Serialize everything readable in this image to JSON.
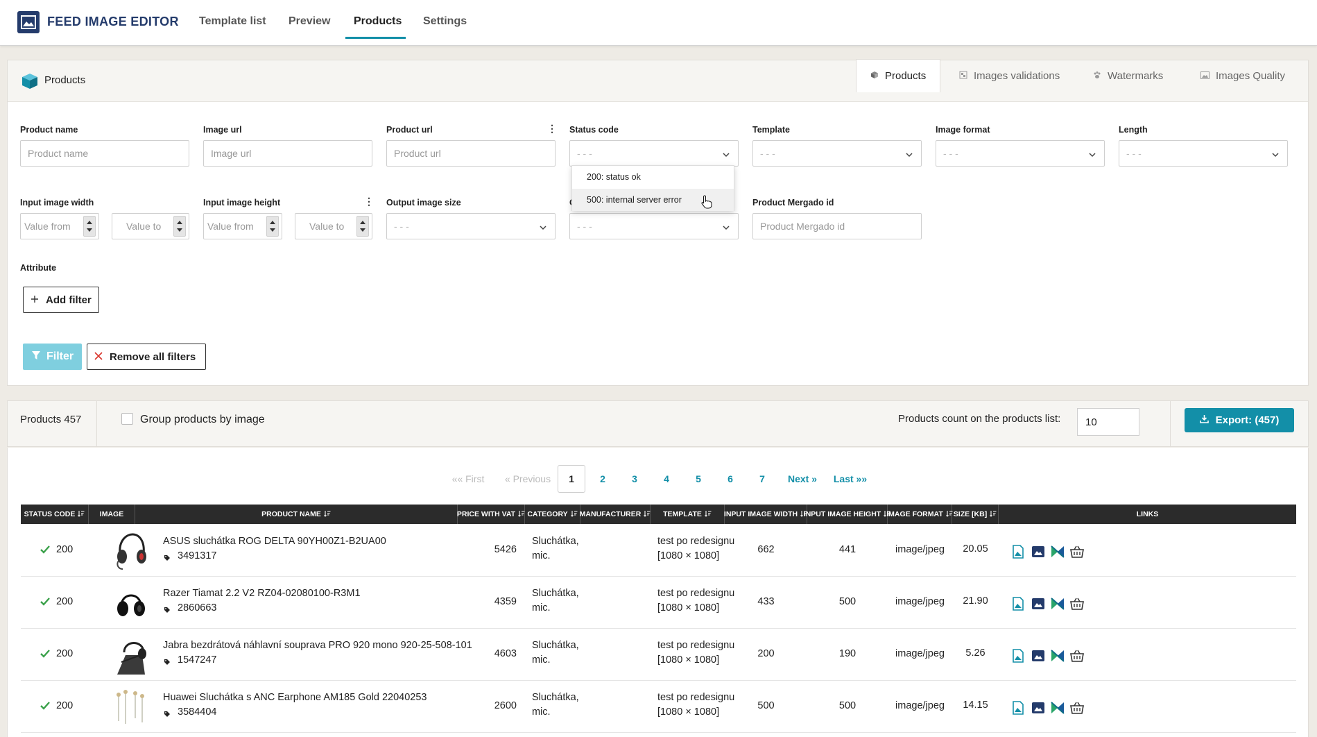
{
  "app": {
    "title": "FEED IMAGE EDITOR"
  },
  "nav": {
    "tabs": [
      "Template list",
      "Preview",
      "Products",
      "Settings"
    ],
    "active": "Products"
  },
  "panel": {
    "title": "Products",
    "tabs": [
      "Products",
      "Images validations",
      "Watermarks",
      "Images Quality"
    ]
  },
  "filters": {
    "product_name": {
      "label": "Product name",
      "placeholder": "Product name"
    },
    "image_url": {
      "label": "Image url",
      "placeholder": "Image url"
    },
    "product_url": {
      "label": "Product url",
      "placeholder": "Product url"
    },
    "status_code": {
      "label": "Status code",
      "value": "- - -"
    },
    "template": {
      "label": "Template",
      "value": "- - -"
    },
    "image_format": {
      "label": "Image format",
      "value": "- - -"
    },
    "length": {
      "label": "Length",
      "value": "- - -"
    },
    "input_width": {
      "label": "Input image width",
      "from": "Value from",
      "to": "Value to"
    },
    "input_height": {
      "label": "Input image height",
      "from": "Value from",
      "to": "Value to"
    },
    "output_size": {
      "label": "Output image size",
      "value": "- - -"
    },
    "hidden_select": {
      "label_fragment": "C",
      "value": "- - -"
    },
    "mergado_id": {
      "label": "Product Mergado id",
      "placeholder": "Product Mergado id"
    },
    "attribute": {
      "label": "Attribute"
    },
    "add_filter": "Add filter",
    "filter_button": "Filter",
    "remove_all": "Remove all filters"
  },
  "status_dropdown": {
    "options": [
      "200: status ok",
      "500: internal server error"
    ],
    "hovered": "500: internal server error"
  },
  "products_bar": {
    "count_label": "Products 457",
    "group_label": "Group products by image",
    "group_checked": false,
    "list_count_label": "Products count on the products list:",
    "list_count_value": "10",
    "export_label": "Export: (457)"
  },
  "pagination": {
    "first": "«« First",
    "previous": "« Previous",
    "pages": [
      "1",
      "2",
      "3",
      "4",
      "5",
      "6",
      "7"
    ],
    "current": "1",
    "next": "Next »",
    "last": "Last »»"
  },
  "table": {
    "columns": [
      "STATUS CODE",
      "IMAGE",
      "PRODUCT NAME",
      "PRICE WITH VAT",
      "CATEGORY",
      "MANUFACTURER",
      "TEMPLATE",
      "INPUT IMAGE WIDTH",
      "INPUT IMAGE HEIGHT",
      "IMAGE FORMAT",
      "SIZE [KB]",
      "LINKS"
    ],
    "rows": [
      {
        "status": "200",
        "name": "ASUS sluchátka ROG DELTA 90YH00Z1-B2UA00",
        "id": "3491317",
        "price": "5426",
        "category1": "Sluchátka,",
        "category2": "mic.",
        "manufacturer": "",
        "template1": "test po redesignu",
        "template2": "[1080 × 1080]",
        "width": "662",
        "height": "441",
        "format": "image/jpeg",
        "size": "20.05",
        "thumb": "gaming-headset"
      },
      {
        "status": "200",
        "name": "Razer Tiamat 2.2 V2 RZ04-02080100-R3M1",
        "id": "2860663",
        "price": "4359",
        "category1": "Sluchátka,",
        "category2": "mic.",
        "manufacturer": "",
        "template1": "test po redesignu",
        "template2": "[1080 × 1080]",
        "width": "433",
        "height": "500",
        "format": "image/jpeg",
        "size": "21.90",
        "thumb": "headphones"
      },
      {
        "status": "200",
        "name": "Jabra bezdrátová náhlavní souprava PRO 920 mono 920-25-508-101",
        "id": "1547247",
        "price": "4603",
        "category1": "Sluchátka,",
        "category2": "mic.",
        "manufacturer": "",
        "template1": "test po redesignu",
        "template2": "[1080 × 1080]",
        "width": "200",
        "height": "190",
        "format": "image/jpeg",
        "size": "5.26",
        "thumb": "mono-headset"
      },
      {
        "status": "200",
        "name": "Huawei Sluchátka s ANC Earphone AM185 Gold 22040253",
        "id": "3584404",
        "price": "2600",
        "category1": "Sluchátka,",
        "category2": "mic.",
        "manufacturer": "",
        "template1": "test po redesignu",
        "template2": "[1080 × 1080]",
        "width": "500",
        "height": "500",
        "format": "image/jpeg",
        "size": "14.15",
        "thumb": "earphones"
      }
    ]
  },
  "colors": {
    "accent": "#138fa8",
    "brand": "#243b6b",
    "ok": "#3aa14a",
    "header": "#2b2b2b"
  }
}
